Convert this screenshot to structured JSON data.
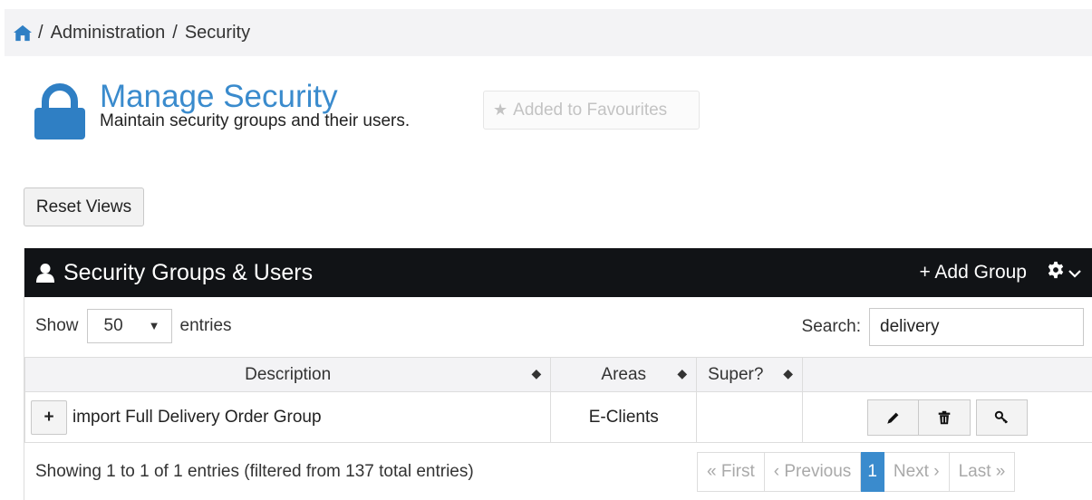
{
  "breadcrumb": {
    "items": [
      "Administration",
      "Security"
    ],
    "separator": "/"
  },
  "header": {
    "title": "Manage Security",
    "subtitle": "Maintain security groups and their users.",
    "favourite_label": "Added to Favourites"
  },
  "toolbar": {
    "reset_label": "Reset Views"
  },
  "panel": {
    "title": "Security Groups & Users",
    "add_group_label": "+ Add Group",
    "show_label": "Show",
    "entries_label": "entries",
    "page_size": "50",
    "search_label": "Search:",
    "search_value": "delivery",
    "columns": [
      "Description",
      "Areas",
      "Super?",
      ""
    ],
    "rows": [
      {
        "description": "import Full Delivery Order Group",
        "areas": "E-Clients",
        "super": ""
      }
    ],
    "info": "Showing 1 to 1 of 1 entries (filtered from 137 total entries)",
    "pager": {
      "first": "« First",
      "previous": "‹ Previous",
      "current": "1",
      "next": "Next ›",
      "last": "Last »"
    }
  },
  "colors": {
    "accent": "#3a8bcd",
    "panel_header": "#111316",
    "icon_blue": "#2f7fc4"
  },
  "icons": [
    "home-icon",
    "lock-icon",
    "star-icon",
    "user-icon",
    "gear-icon",
    "chevron-down-icon",
    "pencil-icon",
    "trash-icon",
    "key-icon",
    "sort-icon"
  ]
}
